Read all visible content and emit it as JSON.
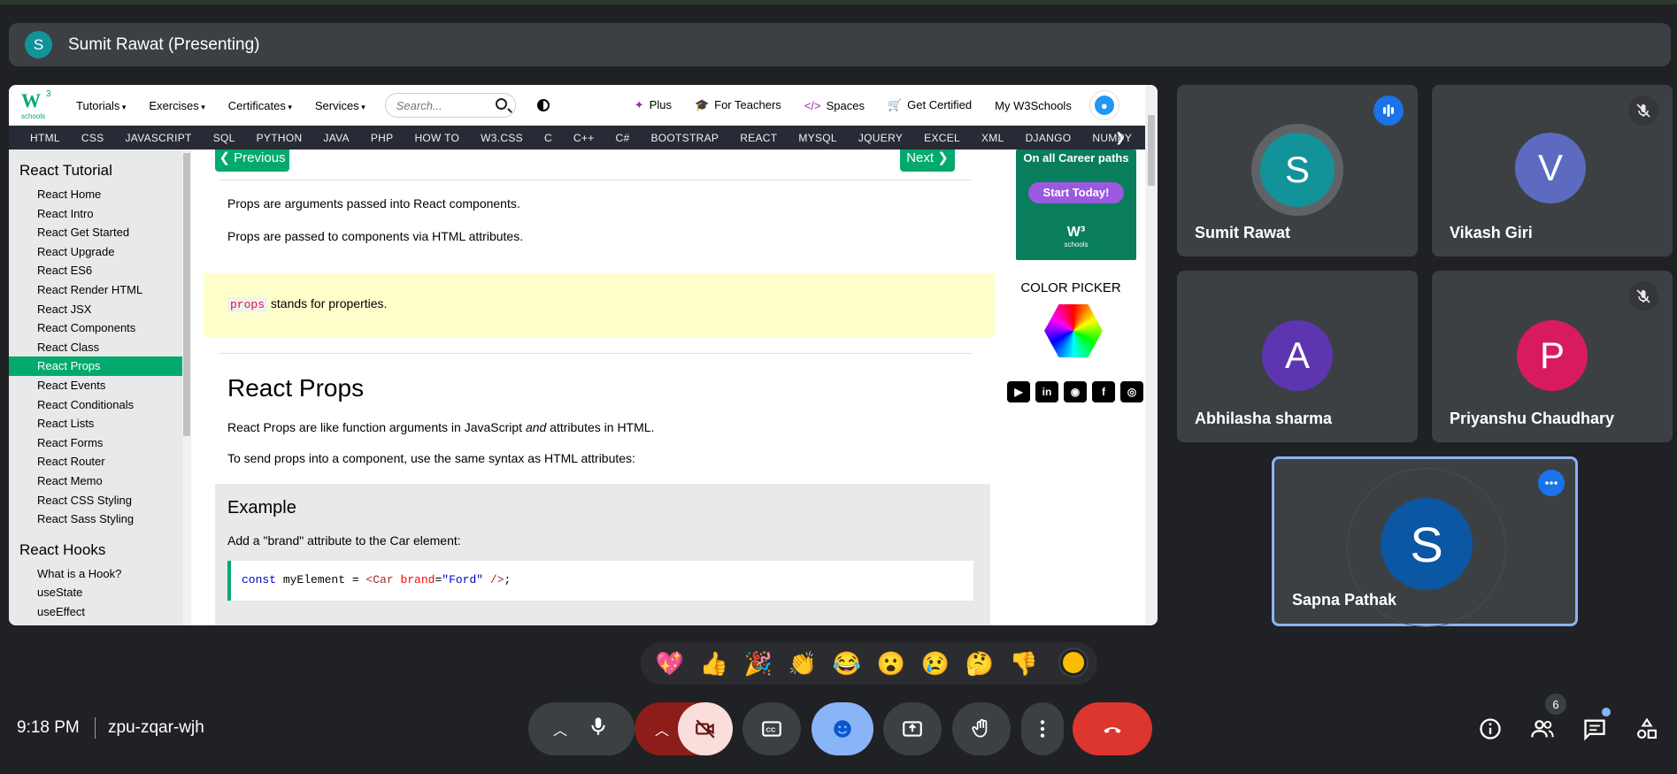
{
  "presenter": {
    "initial": "S",
    "label": "Sumit Rawat (Presenting)"
  },
  "w3": {
    "logo": {
      "mark": "W",
      "sup": "3",
      "sub": "schools"
    },
    "menu": [
      "Tutorials",
      "Exercises",
      "Certificates",
      "Services"
    ],
    "search_placeholder": "Search...",
    "right_links": [
      {
        "icon": "✦",
        "label": "Plus"
      },
      {
        "icon": "🎓",
        "label": "For Teachers"
      },
      {
        "icon": "</>",
        "label": "Spaces"
      },
      {
        "icon": "🛒",
        "label": "Get Certified"
      },
      {
        "icon": "",
        "label": "My W3Schools"
      }
    ],
    "nav": [
      "HTML",
      "CSS",
      "JAVASCRIPT",
      "SQL",
      "PYTHON",
      "JAVA",
      "PHP",
      "HOW TO",
      "W3.CSS",
      "C",
      "C++",
      "C#",
      "BOOTSTRAP",
      "REACT",
      "MYSQL",
      "JQUERY",
      "EXCEL",
      "XML",
      "DJANGO",
      "NUMPY"
    ],
    "nav_arrow": "❯"
  },
  "sidebar": {
    "heading1": "React Tutorial",
    "items1": [
      "React Home",
      "React Intro",
      "React Get Started",
      "React Upgrade",
      "React ES6",
      "React Render HTML",
      "React JSX",
      "React Components",
      "React Class",
      "React Props",
      "React Events",
      "React Conditionals",
      "React Lists",
      "React Forms",
      "React Router",
      "React Memo",
      "React CSS Styling",
      "React Sass Styling"
    ],
    "active": "React Props",
    "heading2": "React Hooks",
    "items2": [
      "What is a Hook?",
      "useState",
      "useEffect"
    ]
  },
  "content": {
    "prev": "❮ Previous",
    "next": "Next ❯",
    "p1": "Props are arguments passed into React components.",
    "p2": "Props are passed to components via HTML attributes.",
    "note_code": "props",
    "note_text": " stands for properties.",
    "heading": "React Props",
    "p3_a": "React Props are like function arguments in JavaScript ",
    "p3_em": "and",
    "p3_b": " attributes in HTML.",
    "p4": "To send props into a component, use the same syntax as HTML attributes:",
    "example_title": "Example",
    "example_desc": "Add a \"brand\" attribute to the Car element:",
    "code": {
      "kw": "const",
      "var": " myElement = ",
      "tag_open": "<Car ",
      "attr": "brand",
      "eq": "=",
      "str": "\"Ford\"",
      "tag_close": " />",
      "end": ";"
    }
  },
  "ad": {
    "line1": "On all Career paths",
    "cta": "Start Today!",
    "logo": "W³",
    "logo_sub": "schools",
    "colorpicker": "COLOR PICKER",
    "socials": [
      "▶",
      "in",
      "◉",
      "f",
      "◎"
    ]
  },
  "participants": [
    {
      "initial": "S",
      "name": "Sumit Rawat",
      "color": "#12939a",
      "state": "speaking"
    },
    {
      "initial": "V",
      "name": "Vikash Giri",
      "color": "#5c6bc0",
      "state": "muted"
    },
    {
      "initial": "A",
      "name": "Abhilasha sharma",
      "color": "#5e35b1",
      "state": ""
    },
    {
      "initial": "P",
      "name": "Priyanshu Chaudhary",
      "color": "#d81b60",
      "state": "muted"
    },
    {
      "initial": "S",
      "name": "Sapna Pathak",
      "color": "#0b57a4",
      "state": "self"
    }
  ],
  "reactions": [
    "💖",
    "👍",
    "🎉",
    "👏",
    "😂",
    "😮",
    "😢",
    "🤔",
    "👎"
  ],
  "footer": {
    "time": "9:18 PM",
    "meeting_code": "zpu-zqar-wjh",
    "people_count": "6"
  },
  "colors": {
    "meet_bg": "#202124",
    "tile_bg": "#3c4043",
    "w3_green": "#04aa6d",
    "end_call": "#ea4335",
    "active_blue": "#8ab4f8"
  }
}
